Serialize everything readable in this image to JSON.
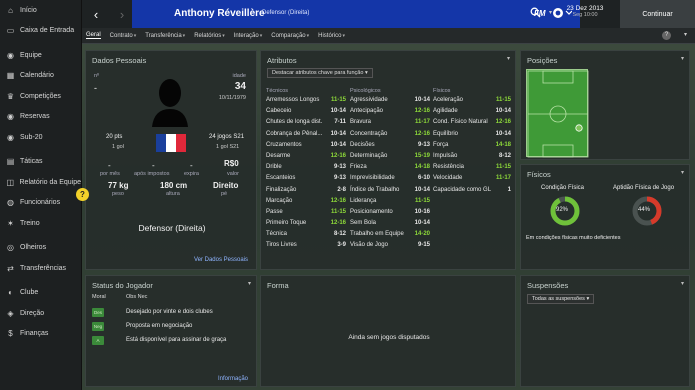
{
  "sidebar": {
    "items": [
      {
        "label": "Início",
        "icon": "home-icon"
      },
      {
        "label": "Caixa de Entrada",
        "icon": "inbox-icon"
      },
      {
        "label": "Equipe",
        "icon": "people-icon"
      },
      {
        "label": "Calendário",
        "icon": "calendar-icon"
      },
      {
        "label": "Competições",
        "icon": "trophy-icon"
      },
      {
        "label": "Reservas",
        "icon": "people-icon"
      },
      {
        "label": "Sub-20",
        "icon": "people-icon"
      },
      {
        "label": "Táticas",
        "icon": "tactics-icon"
      },
      {
        "label": "Relatório da Equipe",
        "icon": "report-icon"
      },
      {
        "label": "Funcionários",
        "icon": "staff-icon"
      },
      {
        "label": "Treino",
        "icon": "training-icon"
      },
      {
        "label": "Olheiros",
        "icon": "binoculars-icon"
      },
      {
        "label": "Transferências",
        "icon": "transfer-icon"
      },
      {
        "label": "Clube",
        "icon": "club-icon"
      },
      {
        "label": "Direção",
        "icon": "board-icon"
      },
      {
        "label": "Finanças",
        "icon": "finance-icon"
      }
    ]
  },
  "header": {
    "player_name": "Anthony Réveillère",
    "player_position": "Defensor (Direita)",
    "fm_logo": "FM",
    "date": "23 Dez 2013",
    "date_sub": "Seg 10:00",
    "continue_label": "Continuar",
    "accent": "#1436a8"
  },
  "tabs": [
    {
      "label": "Geral",
      "active": true
    },
    {
      "label": "Contrato"
    },
    {
      "label": "Transferência"
    },
    {
      "label": "Relatórios"
    },
    {
      "label": "Interação"
    },
    {
      "label": "Comparação"
    },
    {
      "label": "Histórico"
    }
  ],
  "personal": {
    "title": "Dados Pessoais",
    "no_label": "nº",
    "no_value": "-",
    "age_label": "idade",
    "age_value": "34",
    "birth": "10/11/1979",
    "caps_left": "20 pts",
    "caps_left_sub": "1 gol",
    "caps_right": "24 jogos S21",
    "caps_right_sub": "1 gol S21",
    "wage": "-",
    "wage_label": "por mês",
    "after_tax": "-",
    "after_tax_label": "após impostos",
    "expires": "-",
    "expires_label": "expira",
    "value": "R$0",
    "value_label": "valor",
    "weight": "77 kg",
    "weight_label": "peso",
    "height": "180 cm",
    "height_label": "altura",
    "foot": "Direito",
    "foot_label": "pé",
    "position": "Defensor (Direita)",
    "link": "Ver Dados Pessoais"
  },
  "attributes": {
    "title": "Atributos",
    "button": "Destacar atributos chave para função",
    "columns": [
      {
        "header": "Técnicos",
        "rows": [
          {
            "name": "Arremessos Longos",
            "value": "11-15",
            "cls": "g"
          },
          {
            "name": "Cabeceio",
            "value": "10-14",
            "cls": "w"
          },
          {
            "name": "Chutes de longa dist.",
            "value": "7-11",
            "cls": "w"
          },
          {
            "name": "Cobrança de Pênal...",
            "value": "10-14",
            "cls": "w"
          },
          {
            "name": "Cruzamentos",
            "value": "10-14",
            "cls": "w"
          },
          {
            "name": "Desarme",
            "value": "12-16",
            "cls": "g"
          },
          {
            "name": "Drible",
            "value": "9-13",
            "cls": "w"
          },
          {
            "name": "Escanteios",
            "value": "9-13",
            "cls": "w"
          },
          {
            "name": "Finalização",
            "value": "2-8",
            "cls": "w"
          },
          {
            "name": "Marcação",
            "value": "12-16",
            "cls": "g"
          },
          {
            "name": "Passe",
            "value": "11-15",
            "cls": "g"
          },
          {
            "name": "Primeiro Toque",
            "value": "12-16",
            "cls": "g"
          },
          {
            "name": "Técnica",
            "value": "8-12",
            "cls": "w"
          },
          {
            "name": "Tiros Livres",
            "value": "3-9",
            "cls": "w"
          }
        ]
      },
      {
        "header": "Psicológicos",
        "rows": [
          {
            "name": "Agressividade",
            "value": "10-14",
            "cls": "w"
          },
          {
            "name": "Antecipação",
            "value": "12-16",
            "cls": "g"
          },
          {
            "name": "Bravura",
            "value": "11-17",
            "cls": "g"
          },
          {
            "name": "Concentração",
            "value": "12-16",
            "cls": "g"
          },
          {
            "name": "Decisões",
            "value": "9-13",
            "cls": "w"
          },
          {
            "name": "Determinação",
            "value": "15-19",
            "cls": "g"
          },
          {
            "name": "Frieza",
            "value": "14-18",
            "cls": "g"
          },
          {
            "name": "Imprevisibilidade",
            "value": "6-10",
            "cls": "w"
          },
          {
            "name": "Índice de Trabalho",
            "value": "10-14",
            "cls": "w"
          },
          {
            "name": "Liderança",
            "value": "11-15",
            "cls": "g"
          },
          {
            "name": "Posicionamento",
            "value": "10-16",
            "cls": "w"
          },
          {
            "name": "Sem Bola",
            "value": "10-14",
            "cls": "w"
          },
          {
            "name": "Trabalho em Equipe",
            "value": "14-20",
            "cls": "g"
          },
          {
            "name": "Visão de Jogo",
            "value": "9-15",
            "cls": "w"
          }
        ]
      },
      {
        "header": "Físicos",
        "rows": [
          {
            "name": "Aceleração",
            "value": "11-15",
            "cls": "g"
          },
          {
            "name": "Agilidade",
            "value": "10-14",
            "cls": "w"
          },
          {
            "name": "Cond. Físico Natural",
            "value": "12-16",
            "cls": "g"
          },
          {
            "name": "Equilíbrio",
            "value": "10-14",
            "cls": "w"
          },
          {
            "name": "Força",
            "value": "14-18",
            "cls": "g"
          },
          {
            "name": "Impulsão",
            "value": "8-12",
            "cls": "w"
          },
          {
            "name": "Resistência",
            "value": "11-15",
            "cls": "g"
          },
          {
            "name": "Velocidade",
            "value": "11-17",
            "cls": "g"
          },
          {
            "name": "Capacidade como GL",
            "value": "1",
            "cls": "w"
          }
        ]
      }
    ]
  },
  "positions": {
    "title": "Posições"
  },
  "physical": {
    "title": "Físicos",
    "condition_label": "Condição Física",
    "condition_value": "92%",
    "condition_frac": 0.92,
    "fitness_label": "Aptidão Física de Jogo",
    "fitness_value": "44%",
    "fitness_frac": 0.44,
    "note": "Em condições físicas muito deficientes"
  },
  "status": {
    "title": "Status do Jogador",
    "col_morale": "Moral",
    "col_obs": "Obs Nec",
    "rows": [
      {
        "badge": "Des",
        "text": "Desejado por vinte e dois clubes"
      },
      {
        "badge": "Neg",
        "text": "Proposta em negociação"
      },
      {
        "badge": "A",
        "text": "Está disponível para assinar de graça"
      }
    ],
    "link": "Informação"
  },
  "form": {
    "title": "Forma",
    "empty": "Ainda sem jogos disputados"
  },
  "suspensions": {
    "title": "Suspensões",
    "select": "Todas as suspensões"
  }
}
